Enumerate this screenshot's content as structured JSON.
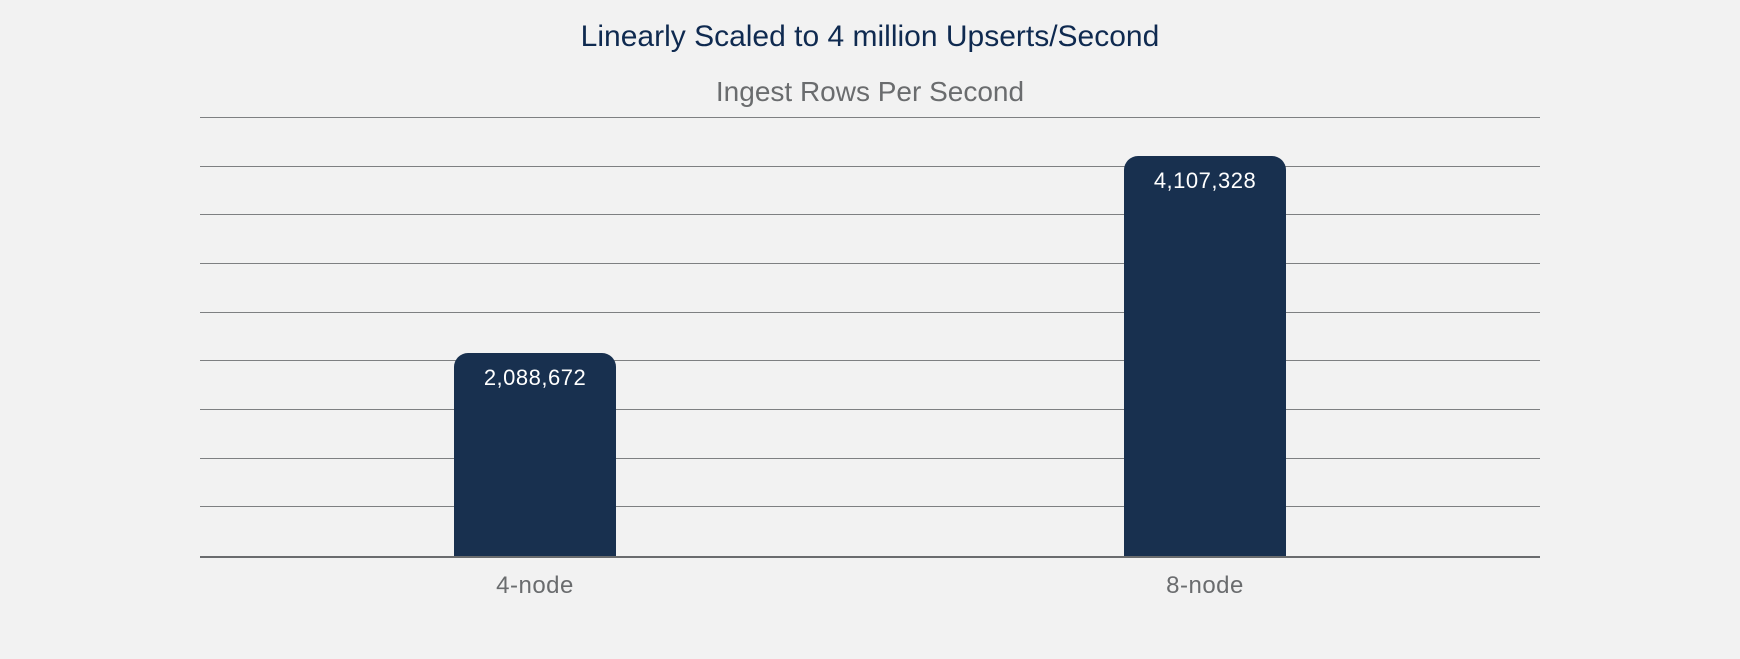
{
  "chart_data": {
    "type": "bar",
    "title": "Linearly Scaled to 4 million Upserts/Second",
    "subtitle": "Ingest Rows Per Second",
    "xlabel": "",
    "ylabel": "",
    "categories": [
      "4-node",
      "8-node"
    ],
    "values": [
      2088672,
      4107328
    ],
    "value_labels": [
      "2,088,672",
      "4,107,328"
    ],
    "ylim": [
      0,
      4500000
    ],
    "gridlines": [
      500000,
      1000000,
      1500000,
      2000000,
      2500000,
      3000000,
      3500000,
      4000000,
      4500000
    ],
    "colors": {
      "bar": "#18304f",
      "grid": "#6a6c6e",
      "title": "#0f2a50"
    }
  }
}
